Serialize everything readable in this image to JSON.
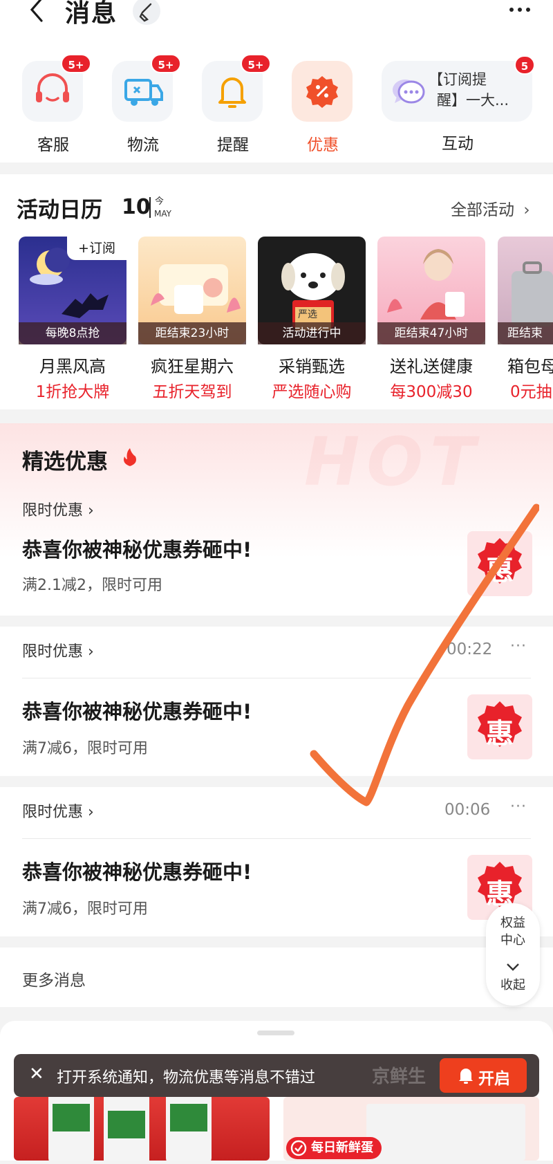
{
  "header": {
    "title": "消息"
  },
  "categories": [
    {
      "label": "客服",
      "badge": "5+",
      "icon": "headset-icon"
    },
    {
      "label": "物流",
      "badge": "5+",
      "icon": "truck-icon"
    },
    {
      "label": "提醒",
      "badge": "5+",
      "icon": "bell-icon"
    },
    {
      "label": "优惠",
      "badge": "",
      "icon": "discount-icon"
    },
    {
      "label": "互动",
      "badge": "5",
      "icon": "chat-icon",
      "preview_line1": "【订阅提",
      "preview_line2": "醒】一大..."
    }
  ],
  "calendar": {
    "title": "活动日历",
    "day": "10",
    "today": "今",
    "month": "MAY",
    "all_label": "全部活动",
    "items": [
      {
        "caption": "每晚8点抢",
        "name": "月黑风高",
        "promo": "1折抢大牌",
        "tag": "+订阅"
      },
      {
        "caption": "距结束23小时",
        "name": "疯狂星期六",
        "promo": "五折天驾到"
      },
      {
        "caption": "活动进行中",
        "name": "采销甄选",
        "promo": "严选随心购",
        "box": "严选"
      },
      {
        "caption": "距结束47小时",
        "name": "送礼送健康",
        "promo": "每300减30"
      },
      {
        "caption": "距结束",
        "name": "箱包母",
        "promo": "0元抽"
      }
    ]
  },
  "featured": {
    "title": "精选优惠",
    "watermark": "HOT",
    "cards": [
      {
        "sub": "限时优惠",
        "title": "恭喜你被神秘优惠券砸中!",
        "desc": "满2.1减2，限时可用",
        "time": ""
      },
      {
        "sub": "限时优惠",
        "title": "恭喜你被神秘优惠券砸中!",
        "desc": "满7减6，限时可用",
        "time": "00:22"
      },
      {
        "sub": "限时优惠",
        "title": "恭喜你被神秘优惠券砸中!",
        "desc": "满7减6，限时可用",
        "time": "00:06"
      }
    ],
    "coupon_char": "惠"
  },
  "more": {
    "label": "更多消息"
  },
  "float": {
    "line1": "权益",
    "line2": "中心",
    "collapse": "收起"
  },
  "bottom": {
    "notify_text": "打开系统通知，物流优惠等消息不错过",
    "open_label": "开启",
    "brand": "京鲜生",
    "egg_tag": "每日新鲜蛋"
  },
  "colors": {
    "accent": "#e8222b",
    "active": "#f0502a",
    "check_mark": "#f2733a"
  }
}
